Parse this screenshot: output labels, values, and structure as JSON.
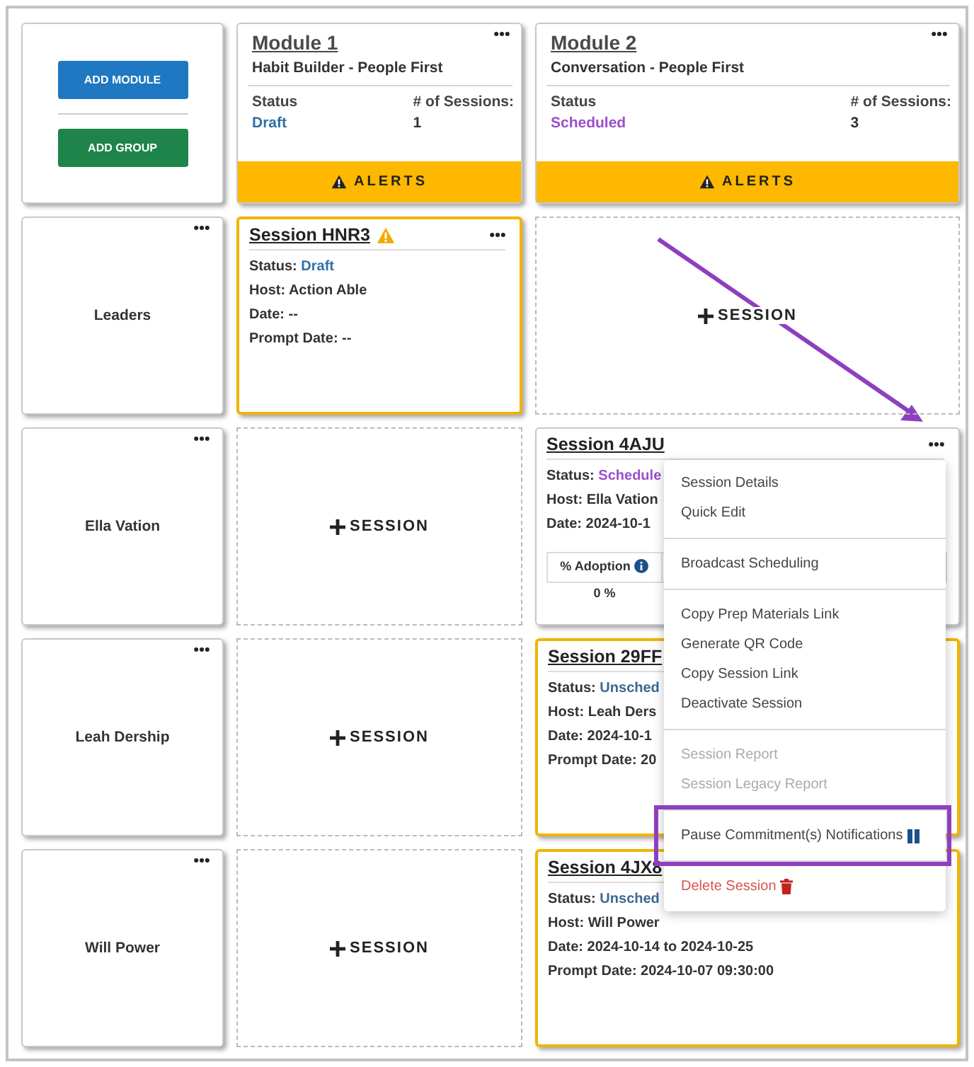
{
  "actions": [
    {
      "label": "ADD MODULE",
      "kind": "primary"
    },
    {
      "label": "ADD GROUP",
      "kind": "success"
    }
  ],
  "modules": [
    {
      "title": "Module 1",
      "subtitle": "Habit Builder - People First",
      "status_label": "Status",
      "status": {
        "text": "Draft",
        "color": "#2f6fa8"
      },
      "count_label": "# of Sessions:",
      "count": "1",
      "alerts": "ALERTS"
    },
    {
      "title": "Module 2",
      "subtitle": "Conversation - People First",
      "status_label": "Status",
      "status": {
        "text": "Scheduled",
        "color": "#9b4fc9"
      },
      "count_label": "# of Sessions:",
      "count": "3",
      "alerts": "ALERTS"
    }
  ],
  "groups": [
    {
      "name": "Leaders",
      "cells": [
        {
          "kind": "session",
          "title": "Session HNR3",
          "warning": true,
          "outlined": true,
          "status_label": "Status:",
          "status": {
            "text": "Draft",
            "color": "#2f6fa8"
          },
          "lines": [
            "Host: Action Able",
            "Date: --",
            "Prompt Date: --"
          ]
        },
        {
          "kind": "add",
          "label": "SESSION"
        }
      ]
    },
    {
      "name": "Ella Vation",
      "cells": [
        {
          "kind": "add",
          "label": "SESSION"
        },
        {
          "kind": "session",
          "title": "Session 4AJU",
          "warning": false,
          "outlined": false,
          "status_label": "Status:",
          "status": {
            "text": "Schedule",
            "color": "#9b4fc9"
          },
          "lines": [
            "Host: Ella Vation",
            "Date: 2024-10-1"
          ],
          "adoption": {
            "label": "% Adoption",
            "value": "0 %"
          }
        }
      ]
    },
    {
      "name": "Leah Dership",
      "cells": [
        {
          "kind": "add",
          "label": "SESSION"
        },
        {
          "kind": "session",
          "title": "Session 29FF",
          "warning": false,
          "outlined": true,
          "status_label": "Status:",
          "status": {
            "text": "Unsched",
            "color": "#3d6792"
          },
          "lines": [
            "Host: Leah Ders",
            "Date: 2024-10-1",
            "Prompt Date: 20"
          ]
        }
      ]
    },
    {
      "name": "Will Power",
      "cells": [
        {
          "kind": "add",
          "label": "SESSION"
        },
        {
          "kind": "session",
          "title": "Session 4JX8",
          "warning": false,
          "outlined": true,
          "status_label": "Status:",
          "status": {
            "text": "Unsched",
            "color": "#3d6792"
          },
          "lines": [
            "Host: Will Power",
            "Date: 2024-10-14 to 2024-10-25",
            "Prompt Date: 2024-10-07 09:30:00"
          ]
        }
      ]
    }
  ],
  "menu": {
    "sections": [
      [
        {
          "label": "Session Details",
          "disabled": false,
          "kind": "normal",
          "annotated": false
        },
        {
          "label": "Quick Edit",
          "disabled": false,
          "kind": "normal",
          "annotated": false
        }
      ],
      [
        {
          "label": "Broadcast Scheduling",
          "disabled": false,
          "kind": "normal",
          "annotated": false
        }
      ],
      [
        {
          "label": "Copy Prep Materials Link",
          "disabled": false,
          "kind": "normal",
          "annotated": false
        },
        {
          "label": "Generate QR Code",
          "disabled": false,
          "kind": "normal",
          "annotated": false
        },
        {
          "label": "Copy Session Link",
          "disabled": false,
          "kind": "normal",
          "annotated": false
        },
        {
          "label": "Deactivate Session",
          "disabled": false,
          "kind": "normal",
          "annotated": false
        }
      ],
      [
        {
          "label": "Session Report",
          "disabled": true,
          "kind": "normal",
          "annotated": false
        },
        {
          "label": "Session Legacy Report",
          "disabled": true,
          "kind": "normal",
          "annotated": false
        }
      ],
      [
        {
          "label": "Pause Commitment(s) Notifications",
          "disabled": false,
          "kind": "pause",
          "annotated": true
        }
      ],
      [
        {
          "label": "Delete Session",
          "disabled": false,
          "kind": "danger",
          "annotated": false
        }
      ]
    ]
  }
}
